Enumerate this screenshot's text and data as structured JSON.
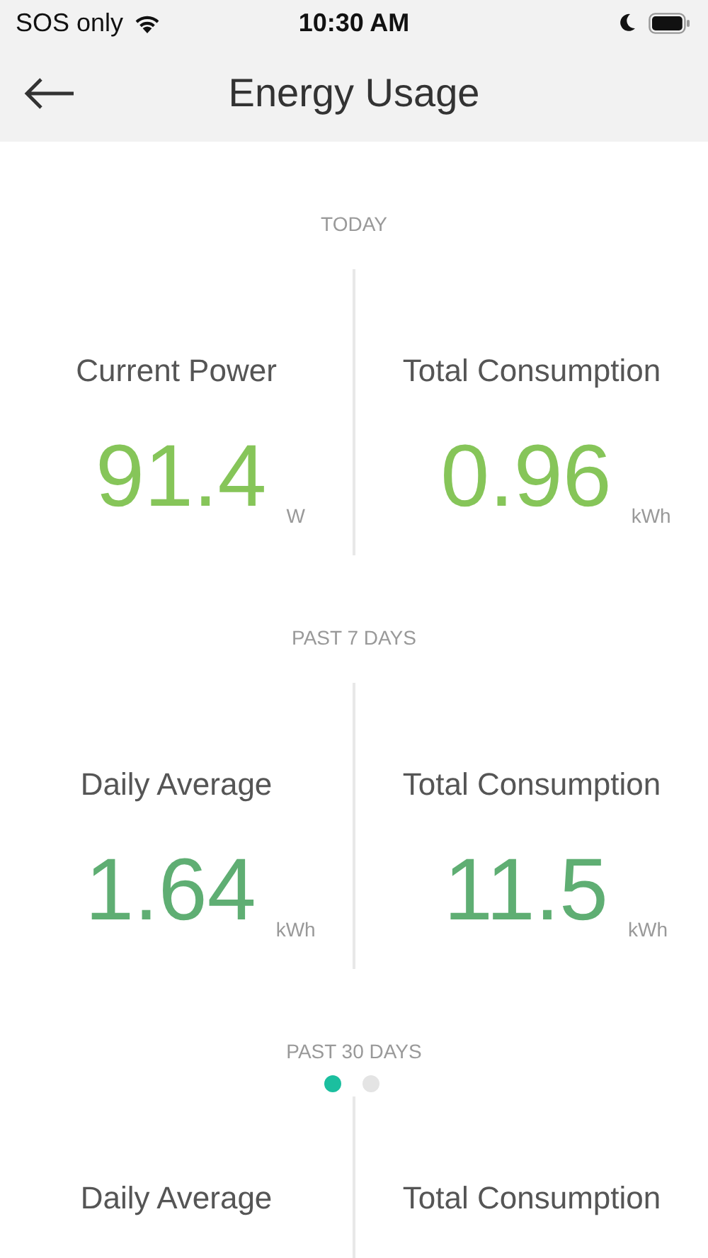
{
  "status_bar": {
    "carrier": "SOS only",
    "time": "10:30 AM"
  },
  "nav": {
    "title": "Energy Usage"
  },
  "sections": [
    {
      "label": "TODAY",
      "color": "#86c559",
      "metrics": [
        {
          "title": "Current Power",
          "value": "91.4",
          "unit": "W"
        },
        {
          "title": "Total Consumption",
          "value": "0.96",
          "unit": "kWh"
        }
      ]
    },
    {
      "label": "PAST 7 DAYS",
      "color": "#5fae73",
      "metrics": [
        {
          "title": "Daily Average",
          "value": "1.64",
          "unit": "kWh"
        },
        {
          "title": "Total Consumption",
          "value": "11.5",
          "unit": "kWh"
        }
      ]
    },
    {
      "label": "PAST 30 DAYS",
      "metrics": [
        {
          "title": "Daily Average"
        },
        {
          "title": "Total Consumption"
        }
      ]
    }
  ],
  "pager": [
    {
      "selected": true
    },
    {
      "selected": false
    }
  ]
}
